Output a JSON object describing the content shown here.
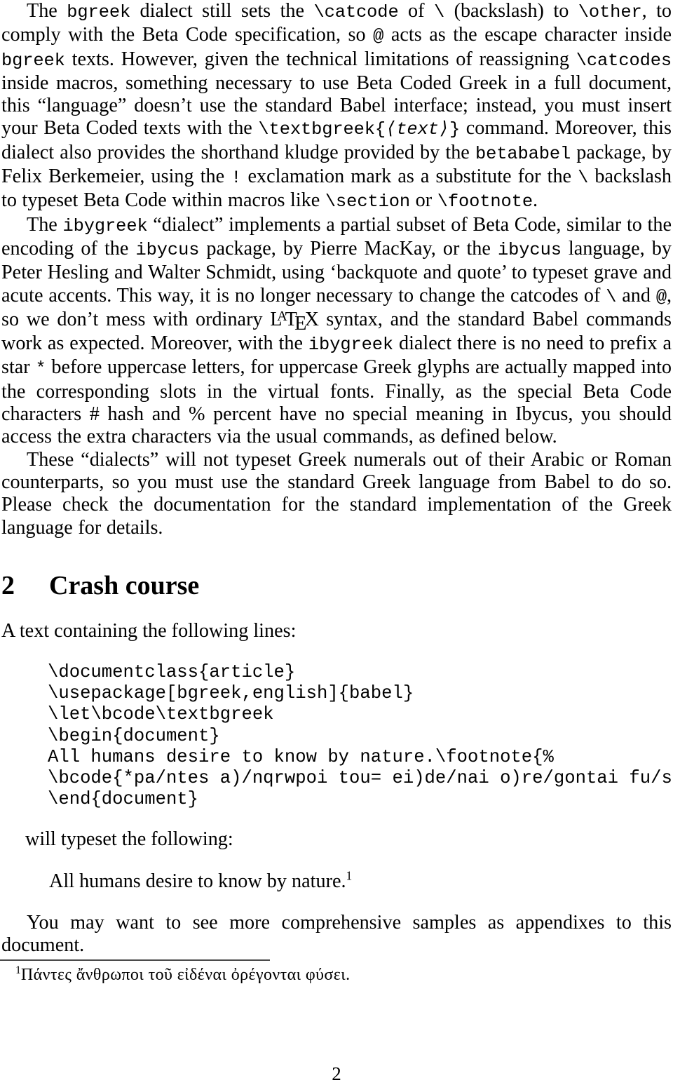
{
  "document": {
    "page_number": "2",
    "paragraphs": [
      {
        "id": "p1",
        "segments": [
          {
            "t": "text",
            "v": "The "
          },
          {
            "t": "code",
            "v": "bgreek"
          },
          {
            "t": "text",
            "v": " dialect still sets the "
          },
          {
            "t": "code",
            "v": "\\catcode"
          },
          {
            "t": "text",
            "v": " of "
          },
          {
            "t": "code",
            "v": "\\"
          },
          {
            "t": "text",
            "v": " (backslash) to "
          },
          {
            "t": "code",
            "v": "\\other"
          },
          {
            "t": "text",
            "v": ", to comply with the Beta Code specification, so "
          },
          {
            "t": "code",
            "v": "@"
          },
          {
            "t": "text",
            "v": " acts as the escape character inside "
          },
          {
            "t": "code",
            "v": "bgreek"
          },
          {
            "t": "text",
            "v": " texts. However, given the technical limitations of reassigning "
          },
          {
            "t": "code",
            "v": "\\catcodes"
          },
          {
            "t": "text",
            "v": " inside macros, something necessary to use Beta Coded Greek in a full document, this “language” doesn’t use the standard Babel interface; instead, you must insert your Beta Coded texts with the "
          },
          {
            "t": "code",
            "v": "\\textbgreek{"
          },
          {
            "t": "codeital",
            "v": "⟨text⟩"
          },
          {
            "t": "code",
            "v": "}"
          },
          {
            "t": "text",
            "v": " command. Moreover, this dialect also provides the shorthand kludge provided by the "
          },
          {
            "t": "code",
            "v": "betababel"
          },
          {
            "t": "text",
            "v": " package, by Felix Berkemeier, using the "
          },
          {
            "t": "code",
            "v": "!"
          },
          {
            "t": "text",
            "v": " exclamation mark as a substitute for the "
          },
          {
            "t": "code",
            "v": "\\"
          },
          {
            "t": "text",
            "v": " backslash to typeset Beta Code within macros like "
          },
          {
            "t": "code",
            "v": "\\section"
          },
          {
            "t": "text",
            "v": " or "
          },
          {
            "t": "code",
            "v": "\\footnote"
          },
          {
            "t": "text",
            "v": "."
          }
        ]
      },
      {
        "id": "p2",
        "segments": [
          {
            "t": "text",
            "v": "The "
          },
          {
            "t": "code",
            "v": "ibygreek"
          },
          {
            "t": "text",
            "v": " “dialect” implements a partial subset of Beta Code, similar to the encoding of the "
          },
          {
            "t": "code",
            "v": "ibycus"
          },
          {
            "t": "text",
            "v": " package, by Pierre MacKay, or the "
          },
          {
            "t": "code",
            "v": "ibycus"
          },
          {
            "t": "text",
            "v": " language, by Peter Hesling and Walter Schmidt, using ‘backquote and quote’ to typeset grave and acute accents. This way, it is no longer necessary to change the catcodes of "
          },
          {
            "t": "code",
            "v": "\\"
          },
          {
            "t": "text",
            "v": " and "
          },
          {
            "t": "code",
            "v": "@"
          },
          {
            "t": "text",
            "v": ", so we don’t mess with ordinary "
          },
          {
            "t": "latex",
            "v": "LaTeX"
          },
          {
            "t": "text",
            "v": " syntax, and the standard Babel commands work as expected. Moreover, with the "
          },
          {
            "t": "code",
            "v": "ibygreek"
          },
          {
            "t": "text",
            "v": " dialect there is no need to prefix a star "
          },
          {
            "t": "code",
            "v": "*"
          },
          {
            "t": "text",
            "v": " before uppercase letters, for uppercase Greek glyphs are actually mapped into the corresponding slots in the virtual fonts. Finally, as the special Beta Code characters # hash and % percent have no special meaning in Ibycus, you should access the extra characters via the usual commands, as defined below."
          }
        ]
      },
      {
        "id": "p3",
        "segments": [
          {
            "t": "text",
            "v": "These “dialects” will not typeset Greek numerals out of their Arabic or Roman counterparts, so you must use the standard Greek language from Babel to do so. Please check the documentation for the standard implementation of the Greek language for details."
          }
        ]
      }
    ],
    "section": {
      "number": "2",
      "title": "Crash course"
    },
    "lead_line": "A text containing the following lines:",
    "code_block": [
      "\\documentclass{article}",
      "\\usepackage[bgreek,english]{babel}",
      "\\let\\bcode\\textbgreek",
      "\\begin{document}",
      "All humans desire to know by nature.\\footnote{%",
      "\\bcode{*pa/ntes a)/nqrwpoi tou= ei)de/nai o)re/gontai fu/sei.}}",
      "\\end{document}"
    ],
    "typeset_line": "will typeset the following:",
    "quote": {
      "text": "All humans desire to know by nature.",
      "footnote_marker": "1"
    },
    "closing_paragraph": "You may want to see more comprehensive samples as appendixes to this document.",
    "footnote": {
      "marker": "1",
      "text": "Πάντες ἄνθρωποι τοῦ εἰδέναι ὀρέγονται φύσει."
    }
  }
}
